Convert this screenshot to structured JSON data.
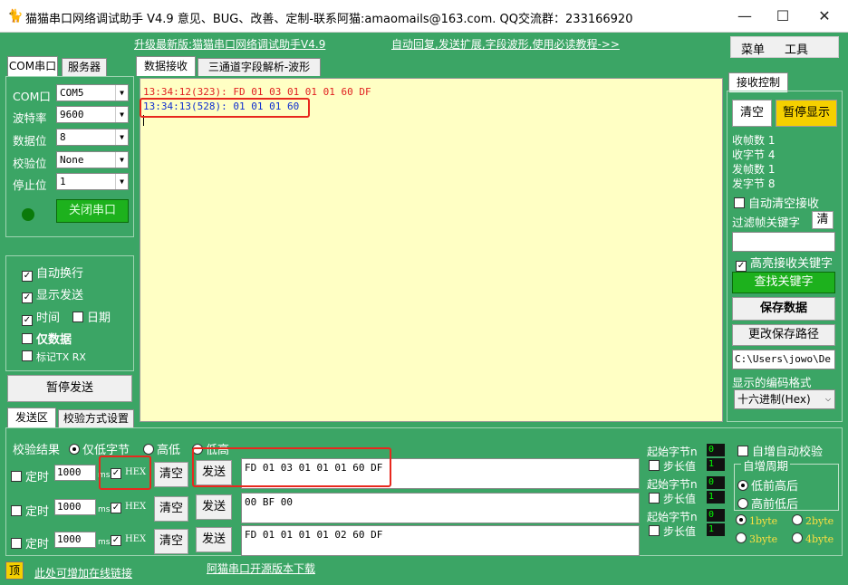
{
  "title": "猫猫串口网络调试助手 V4.9 意见、BUG、改善、定制-联系阿猫:amaomails@163.com. QQ交流群：233166920",
  "window_buttons": {
    "minimize": "—",
    "maximize": "☐",
    "close": "✕"
  },
  "top_links": {
    "upgrade": "升级最新版:猫猫串口网络调试助手V4.9",
    "auto_reply": "自动回复,发送扩展,字段波形,使用必读教程->>"
  },
  "menu": {
    "menu": "菜单",
    "tools": "工具"
  },
  "left_tabs": [
    "COM串口",
    "服务器"
  ],
  "center_tabs": [
    "数据接收",
    "三通道字段解析-波形"
  ],
  "serial": {
    "com_label": "COM口",
    "com_value": "COM5",
    "baud_label": "波特率",
    "baud_value": "9600",
    "data_label": "数据位",
    "data_value": "8",
    "parity_label": "校验位",
    "parity_value": "None",
    "stop_label": "停止位",
    "stop_value": "1",
    "close_port": "关闭串口"
  },
  "options": {
    "auto_wrap": "自动换行",
    "show_send": "显示发送",
    "time": "时间",
    "date": "日期",
    "data_only": "仅数据",
    "mark_txrx": "标记TX RX",
    "pause_send": "暂停发送"
  },
  "receive_lines": [
    "13:34:12(323): FD 01 03 01 01 01 60 DF",
    "13:34:13(528): 01 01 01 60"
  ],
  "receive_control": {
    "title": "接收控制",
    "clear": "清空",
    "pause_display": "暂停显示",
    "frames_rx_label": "收帧数",
    "frames_rx": "1",
    "bytes_rx_label": "收字节",
    "bytes_rx": "4",
    "frames_tx_label": "发帧数",
    "frames_tx": "1",
    "bytes_tx_label": "发字节",
    "bytes_tx": "8",
    "auto_clear": "自动清空接收",
    "filter_label": "过滤帧关键字",
    "filter_clear": "清",
    "filter_value": "",
    "highlight": "高亮接收关键字",
    "find_keyword": "查找关键字",
    "save_data": "保存数据",
    "change_path": "更改保存路径",
    "path": "C:\\Users\\jowo\\De",
    "encoding_label": "显示的编码格式",
    "encoding_value": "十六进制(Hex)"
  },
  "bottom_tabs": [
    "发送区",
    "校验方式设置"
  ],
  "checksum": {
    "label": "校验结果",
    "opt1": "仅低字节",
    "opt2": "高低",
    "opt3": "低高"
  },
  "send_rows": [
    {
      "timer": "定时",
      "interval": "1000",
      "unit": "ms",
      "hex": "HEX",
      "clear": "清空",
      "send": "发送",
      "data": "FD 01 03 01 01 01 60 DF"
    },
    {
      "timer": "定时",
      "interval": "1000",
      "unit": "ms",
      "hex": "HEX",
      "clear": "清空",
      "send": "发送",
      "data": "00 BF 00"
    },
    {
      "timer": "定时",
      "interval": "1000",
      "unit": "ms",
      "hex": "HEX",
      "clear": "清空",
      "send": "发送",
      "data": "FD 01 01 01 01 02 60 DF"
    }
  ],
  "send_extra": {
    "start_byte": "起始字节n",
    "start_val": "0",
    "step": "步长值",
    "step_val": "1",
    "auto_inc": "自增自动校验",
    "inc_period": "自增周期",
    "low_high": "低前高后",
    "high_low": "高前低后",
    "byte1": "1byte",
    "byte2": "2byte",
    "byte3": "3byte",
    "byte4": "4byte"
  },
  "footer": {
    "top": "顶",
    "online_link": "此处可增加在线链接",
    "open_source": "阿猫串口开源版本下载"
  }
}
